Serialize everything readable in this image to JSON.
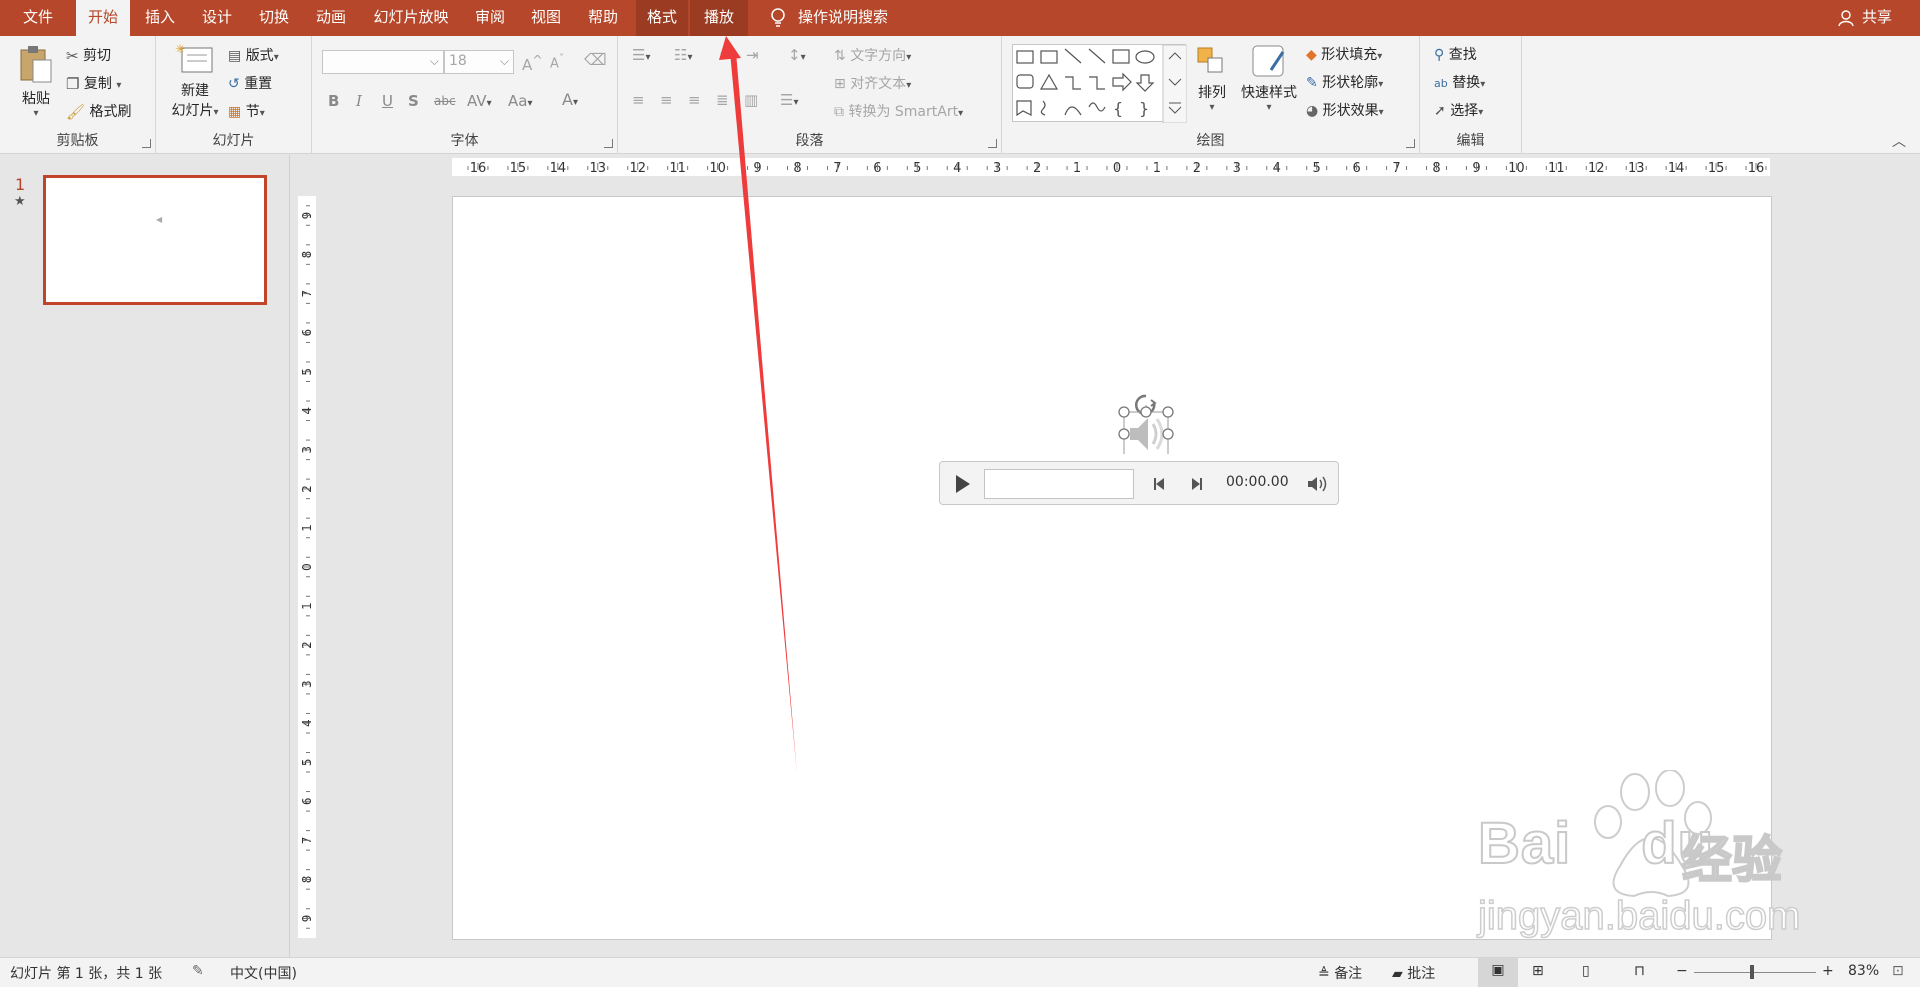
{
  "tabs": [
    {
      "label": "文件",
      "state": "normal"
    },
    {
      "label": "开始",
      "state": "active"
    },
    {
      "label": "插入",
      "state": "normal"
    },
    {
      "label": "设计",
      "state": "normal"
    },
    {
      "label": "切换",
      "state": "normal"
    },
    {
      "label": "动画",
      "state": "normal"
    },
    {
      "label": "幻灯片放映",
      "state": "normal"
    },
    {
      "label": "审阅",
      "state": "normal"
    },
    {
      "label": "视图",
      "state": "normal"
    },
    {
      "label": "帮助",
      "state": "normal"
    },
    {
      "label": "格式",
      "state": "contextual"
    },
    {
      "label": "播放",
      "state": "contextual"
    }
  ],
  "tell_me": "操作说明搜索",
  "share": "共享",
  "ribbon": {
    "clipboard": {
      "group": "剪贴板",
      "paste": "粘贴",
      "cut": "剪切",
      "copy": "复制",
      "format_painter": "格式刷"
    },
    "slides": {
      "group": "幻灯片",
      "new_slide_line1": "新建",
      "new_slide_line2": "幻灯片",
      "layout": "版式",
      "reset": "重置",
      "section": "节"
    },
    "font": {
      "group": "字体",
      "font_name": "",
      "font_size": "18",
      "bold": "B",
      "italic": "I",
      "underline": "U",
      "shadow": "S",
      "strike": "abc",
      "spacing": "AV",
      "case": "Aa",
      "color": "A",
      "grow": "A",
      "shrink": "A"
    },
    "paragraph": {
      "group": "段落",
      "text_direction": "文字方向",
      "align_text": "对齐文本",
      "smartart": "转换为 SmartArt"
    },
    "drawing": {
      "group": "绘图",
      "arrange": "排列",
      "quick_styles": "快速样式",
      "shape_fill": "形状填充",
      "shape_outline": "形状轮廓",
      "shape_effects": "形状效果"
    },
    "editing": {
      "group": "编辑",
      "find": "查找",
      "replace": "替换",
      "select": "选择"
    }
  },
  "thumbnails": {
    "slide_number": "1"
  },
  "ruler": {
    "h_labels": [
      "16",
      "15",
      "14",
      "13",
      "12",
      "11",
      "10",
      "9",
      "8",
      "7",
      "6",
      "5",
      "4",
      "3",
      "2",
      "1",
      "0",
      "1",
      "2",
      "3",
      "4",
      "5",
      "6",
      "7",
      "8",
      "9",
      "10",
      "11",
      "12",
      "13",
      "14",
      "15",
      "16"
    ],
    "v_labels": [
      "9",
      "8",
      "7",
      "6",
      "5",
      "4",
      "3",
      "2",
      "1",
      "0",
      "1",
      "2",
      "3",
      "4",
      "5",
      "6",
      "7",
      "8",
      "9"
    ]
  },
  "player": {
    "time": "00:00.00"
  },
  "status": {
    "slide_info": "幻灯片 第 1 张，共 1 张",
    "language": "中文(中国)",
    "notes": "备注",
    "comments": "批注",
    "zoom": "83%"
  },
  "colors": {
    "accent": "#b7472a",
    "arrow": "#ee3b3b"
  },
  "watermark": {
    "brand": "Bai",
    "brand_tail": "du",
    "brand_cn": "经验",
    "url": "jingyan.baidu.com"
  }
}
